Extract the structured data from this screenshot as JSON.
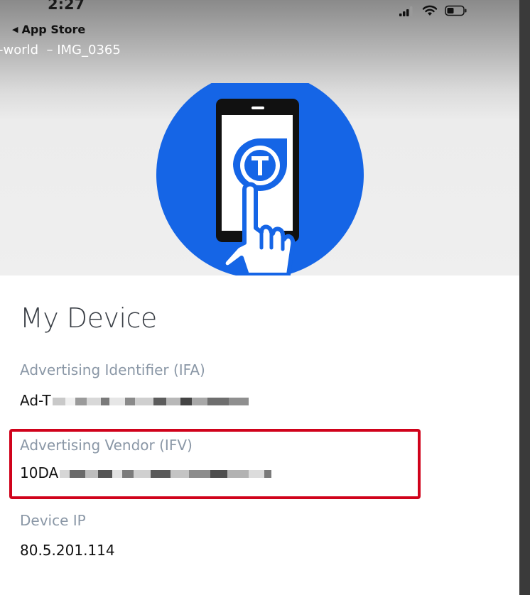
{
  "status_bar": {
    "time": "2:27",
    "icons": [
      "signal-icon",
      "wifi-icon",
      "battery-icon"
    ]
  },
  "back_link": {
    "label": "App Store"
  },
  "overlay_title": "-world  – IMG_0365",
  "colors": {
    "accent_blue": "#1565e6",
    "highlight_red": "#d0021b",
    "label_gray": "#8a97a6",
    "header_gray": "#efefef"
  },
  "page": {
    "title": "My Device",
    "fields": [
      {
        "label": "Advertising Identifier (IFA)",
        "value": "Ad-T"
      },
      {
        "label": "Advertising Vendor (IFV)",
        "value": "10DA"
      },
      {
        "label": "Device IP",
        "value": "80.5.201.114"
      }
    ]
  }
}
